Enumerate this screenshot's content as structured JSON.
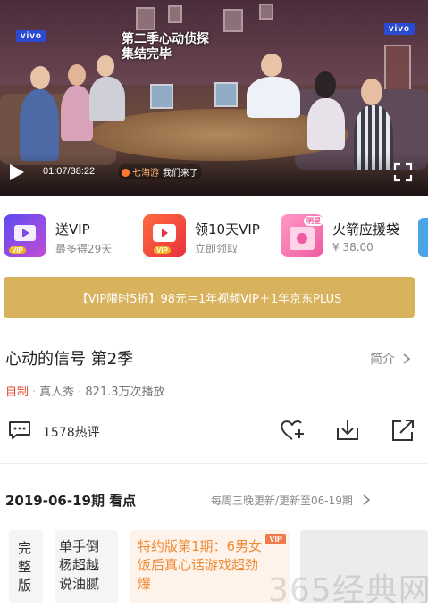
{
  "player": {
    "caption_sign": "第二季心动侦探\n集结完毕",
    "logo_text": "vivo",
    "time": "01:07/38:22",
    "danmaku_nick": "七海游",
    "danmaku_text": "我们来了",
    "icons": [
      "play-icon",
      "fullscreen-icon"
    ]
  },
  "promos": [
    {
      "title": "送VIP",
      "sub": "最多得29天",
      "icon": "gift-vip-icon",
      "badge": "VIP"
    },
    {
      "title": "领10天VIP",
      "sub": "立即领取",
      "icon": "tv-vip-icon",
      "badge": "VIP"
    },
    {
      "title": "火箭应援袋",
      "sub": "¥ 38.00",
      "icon": "rocket-bag-icon",
      "badge": "明星"
    }
  ],
  "vip_banner": "【VIP限时5折】98元＝1年视频VIP＋1年京东PLUS",
  "show": {
    "title": "心动的信号 第2季",
    "intro_link": "简介",
    "tag_self": "自制",
    "genre": "真人秀",
    "plays": "821.3万次播放"
  },
  "actions": {
    "comment_count": "1578热评",
    "icons": [
      "comment-icon",
      "like-plus-icon",
      "download-icon",
      "share-icon"
    ]
  },
  "episodes": {
    "heading": "2019-06-19期 看点",
    "update_info": "每周三晚更新/更新至06-19期",
    "cards": [
      {
        "text": "完\n整\n版"
      },
      {
        "text": "单手倒\n杨超越\n说油腻"
      },
      {
        "text": "特约版第1期：6男女\n饭后真心话游戏超劲\n爆",
        "vip": "VIP"
      },
      {
        "text": ""
      }
    ]
  },
  "watermark": "365经典网",
  "colors": {
    "accent": "#f08a35",
    "banner": "#d9b25e",
    "self_tag": "#e24a2c"
  }
}
